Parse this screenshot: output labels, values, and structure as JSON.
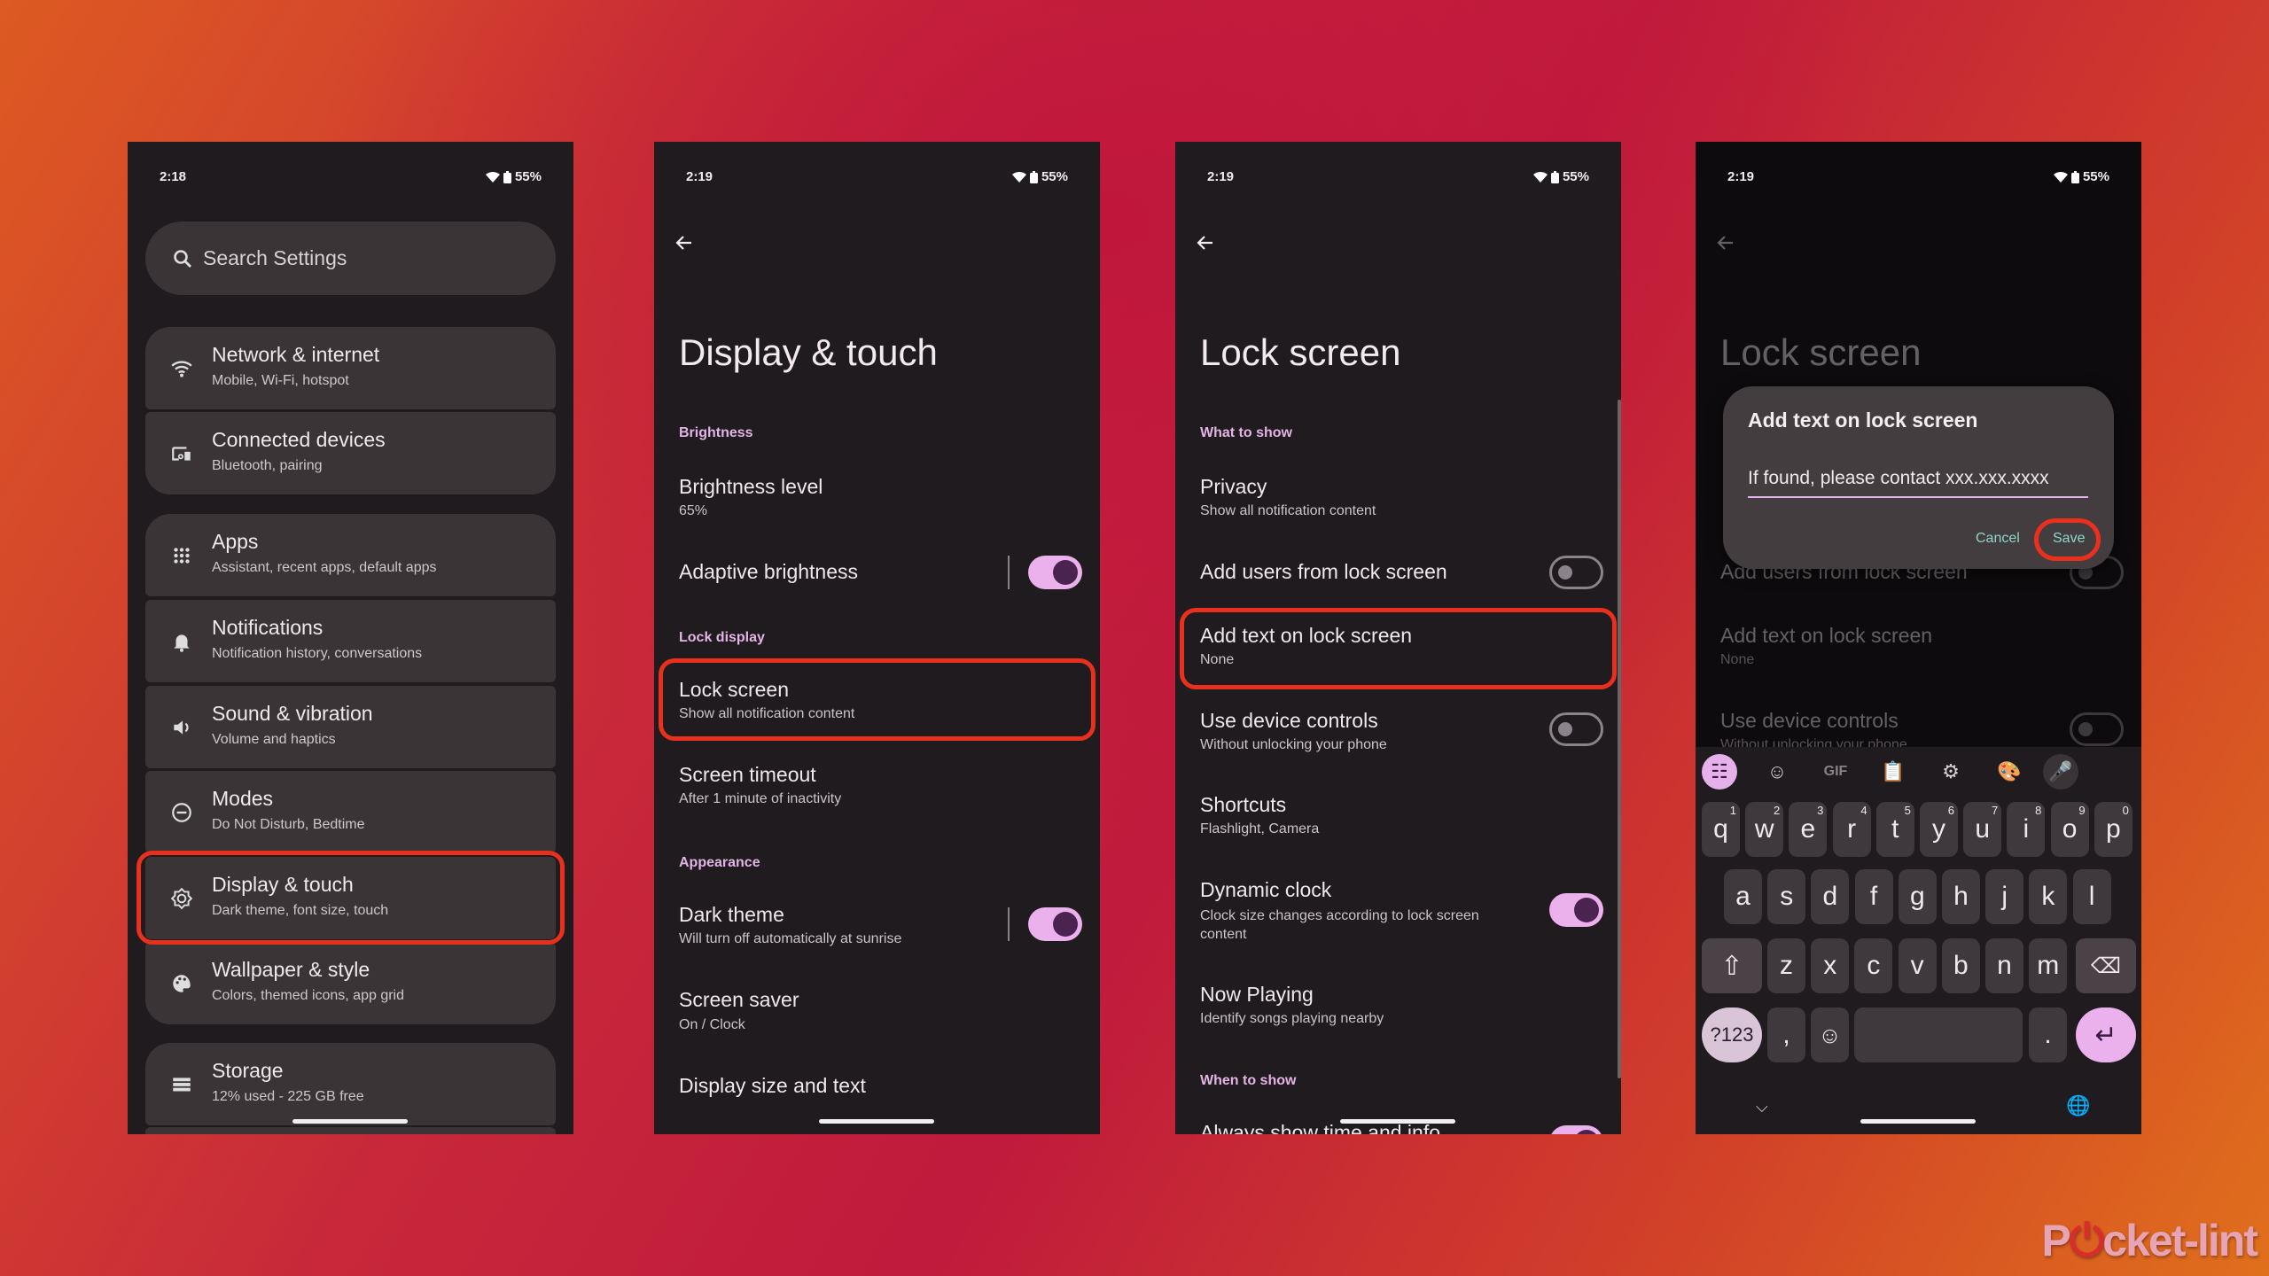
{
  "panels": [
    {
      "time": "2:18",
      "battery": "55%",
      "search_placeholder": "Search Settings",
      "items": [
        {
          "title": "Network & internet",
          "subtitle": "Mobile, Wi-Fi, hotspot",
          "icon": "wifi-icon"
        },
        {
          "title": "Connected devices",
          "subtitle": "Bluetooth, pairing",
          "icon": "devices-icon"
        },
        {
          "title": "Apps",
          "subtitle": "Assistant, recent apps, default apps",
          "icon": "apps-grid-icon"
        },
        {
          "title": "Notifications",
          "subtitle": "Notification history, conversations",
          "icon": "bell-icon"
        },
        {
          "title": "Sound & vibration",
          "subtitle": "Volume and haptics",
          "icon": "speaker-icon"
        },
        {
          "title": "Modes",
          "subtitle": "Do Not Disturb, Bedtime",
          "icon": "modes-icon"
        },
        {
          "title": "Display & touch",
          "subtitle": "Dark theme, font size, touch",
          "icon": "brightness-gear-icon",
          "highlighted": true
        },
        {
          "title": "Wallpaper & style",
          "subtitle": "Colors, themed icons, app grid",
          "icon": "palette-icon"
        },
        {
          "title": "Storage",
          "subtitle": "12% used - 225 GB free",
          "icon": "storage-icon"
        }
      ]
    },
    {
      "time": "2:19",
      "battery": "55%",
      "title": "Display & touch",
      "sections": {
        "brightness": "Brightness",
        "lock_display": "Lock display",
        "appearance": "Appearance"
      },
      "items": {
        "brightness_level": {
          "title": "Brightness level",
          "subtitle": "65%"
        },
        "adaptive_brightness": {
          "title": "Adaptive brightness",
          "on": true
        },
        "lock_screen": {
          "title": "Lock screen",
          "subtitle": "Show all notification content",
          "highlighted": true
        },
        "screen_timeout": {
          "title": "Screen timeout",
          "subtitle": "After 1 minute of inactivity"
        },
        "dark_theme": {
          "title": "Dark theme",
          "subtitle": "Will turn off automatically at sunrise",
          "on": true
        },
        "screen_saver": {
          "title": "Screen saver",
          "subtitle": "On / Clock"
        },
        "display_size": {
          "title": "Display size and text"
        }
      }
    },
    {
      "time": "2:19",
      "battery": "55%",
      "title": "Lock screen",
      "sections": {
        "what_to_show": "What to show",
        "when_to_show": "When to show"
      },
      "items": {
        "privacy": {
          "title": "Privacy",
          "subtitle": "Show all notification content"
        },
        "add_users": {
          "title": "Add users from lock screen",
          "on": false
        },
        "add_text": {
          "title": "Add text on lock screen",
          "subtitle": "None",
          "highlighted": true
        },
        "device_controls": {
          "title": "Use device controls",
          "subtitle": "Without unlocking your phone",
          "on": false
        },
        "shortcuts": {
          "title": "Shortcuts",
          "subtitle": "Flashlight, Camera"
        },
        "dynamic_clock": {
          "title": "Dynamic clock",
          "subtitle": "Clock size changes according to lock screen content",
          "on": true
        },
        "now_playing": {
          "title": "Now Playing",
          "subtitle": "Identify songs playing nearby"
        },
        "always_show": {
          "title": "Always show time and info",
          "on": true
        }
      }
    },
    {
      "time": "2:19",
      "battery": "55%",
      "title": "Lock screen",
      "bg_items": {
        "add_users": "Add users from lock screen",
        "add_text": "Add text on lock screen",
        "add_text_sub": "None",
        "device_controls": "Use device controls",
        "device_controls_sub": "Without unlocking your phone"
      },
      "dialog": {
        "title": "Add text on lock screen",
        "value": "If found, please contact xxx.xxx.xxxx",
        "cancel": "Cancel",
        "save": "Save"
      },
      "keyboard": {
        "toolbar": [
          "apps-grid-icon",
          "sticker-icon",
          "GIF",
          "clipboard-icon",
          "settings-icon",
          "palette-icon",
          "microphone-icon"
        ],
        "row1": [
          "q",
          "w",
          "e",
          "r",
          "t",
          "y",
          "u",
          "i",
          "o",
          "p"
        ],
        "row1_hints": [
          "1",
          "2",
          "3",
          "4",
          "5",
          "6",
          "7",
          "8",
          "9",
          "0"
        ],
        "row2": [
          "a",
          "s",
          "d",
          "f",
          "g",
          "h",
          "j",
          "k",
          "l"
        ],
        "row3": [
          "z",
          "x",
          "c",
          "v",
          "b",
          "n",
          "m"
        ],
        "symbols": "?123",
        "comma": ",",
        "period": "."
      }
    }
  ],
  "colors": {
    "accent": "#ebb1ec",
    "highlight": "#e8301c",
    "link": "#8fd6c8",
    "section": "#e3b4e6"
  },
  "watermark": "Pocket-lint"
}
